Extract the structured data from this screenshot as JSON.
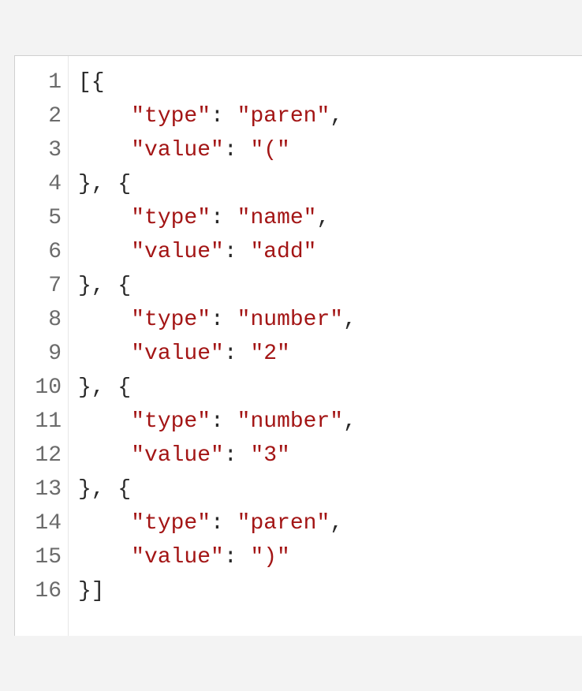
{
  "editor": {
    "line_numbers": [
      "1",
      "2",
      "3",
      "4",
      "5",
      "6",
      "7",
      "8",
      "9",
      "10",
      "11",
      "12",
      "13",
      "14",
      "15",
      "16"
    ],
    "lines": [
      [
        {
          "cls": "tok-punct",
          "text": "[{"
        }
      ],
      [
        {
          "cls": "indent",
          "text": "    "
        },
        {
          "cls": "tok-key",
          "text": "\"type\""
        },
        {
          "cls": "tok-colon",
          "text": ": "
        },
        {
          "cls": "tok-string",
          "text": "\"paren\""
        },
        {
          "cls": "tok-punct",
          "text": ","
        }
      ],
      [
        {
          "cls": "indent",
          "text": "    "
        },
        {
          "cls": "tok-key",
          "text": "\"value\""
        },
        {
          "cls": "tok-colon",
          "text": ": "
        },
        {
          "cls": "tok-string",
          "text": "\"(\""
        }
      ],
      [
        {
          "cls": "tok-punct",
          "text": "}, {"
        }
      ],
      [
        {
          "cls": "indent",
          "text": "    "
        },
        {
          "cls": "tok-key",
          "text": "\"type\""
        },
        {
          "cls": "tok-colon",
          "text": ": "
        },
        {
          "cls": "tok-string",
          "text": "\"name\""
        },
        {
          "cls": "tok-punct",
          "text": ","
        }
      ],
      [
        {
          "cls": "indent",
          "text": "    "
        },
        {
          "cls": "tok-key",
          "text": "\"value\""
        },
        {
          "cls": "tok-colon",
          "text": ": "
        },
        {
          "cls": "tok-string",
          "text": "\"add\""
        }
      ],
      [
        {
          "cls": "tok-punct",
          "text": "}, {"
        }
      ],
      [
        {
          "cls": "indent",
          "text": "    "
        },
        {
          "cls": "tok-key",
          "text": "\"type\""
        },
        {
          "cls": "tok-colon",
          "text": ": "
        },
        {
          "cls": "tok-string",
          "text": "\"number\""
        },
        {
          "cls": "tok-punct",
          "text": ","
        }
      ],
      [
        {
          "cls": "indent",
          "text": "    "
        },
        {
          "cls": "tok-key",
          "text": "\"value\""
        },
        {
          "cls": "tok-colon",
          "text": ": "
        },
        {
          "cls": "tok-string",
          "text": "\"2\""
        }
      ],
      [
        {
          "cls": "tok-punct",
          "text": "}, {"
        }
      ],
      [
        {
          "cls": "indent",
          "text": "    "
        },
        {
          "cls": "tok-key",
          "text": "\"type\""
        },
        {
          "cls": "tok-colon",
          "text": ": "
        },
        {
          "cls": "tok-string",
          "text": "\"number\""
        },
        {
          "cls": "tok-punct",
          "text": ","
        }
      ],
      [
        {
          "cls": "indent",
          "text": "    "
        },
        {
          "cls": "tok-key",
          "text": "\"value\""
        },
        {
          "cls": "tok-colon",
          "text": ": "
        },
        {
          "cls": "tok-string",
          "text": "\"3\""
        }
      ],
      [
        {
          "cls": "tok-punct",
          "text": "}, {"
        }
      ],
      [
        {
          "cls": "indent",
          "text": "    "
        },
        {
          "cls": "tok-key",
          "text": "\"type\""
        },
        {
          "cls": "tok-colon",
          "text": ": "
        },
        {
          "cls": "tok-string",
          "text": "\"paren\""
        },
        {
          "cls": "tok-punct",
          "text": ","
        }
      ],
      [
        {
          "cls": "indent",
          "text": "    "
        },
        {
          "cls": "tok-key",
          "text": "\"value\""
        },
        {
          "cls": "tok-colon",
          "text": ": "
        },
        {
          "cls": "tok-string",
          "text": "\")\""
        }
      ],
      [
        {
          "cls": "tok-punct",
          "text": "}]"
        }
      ]
    ]
  }
}
